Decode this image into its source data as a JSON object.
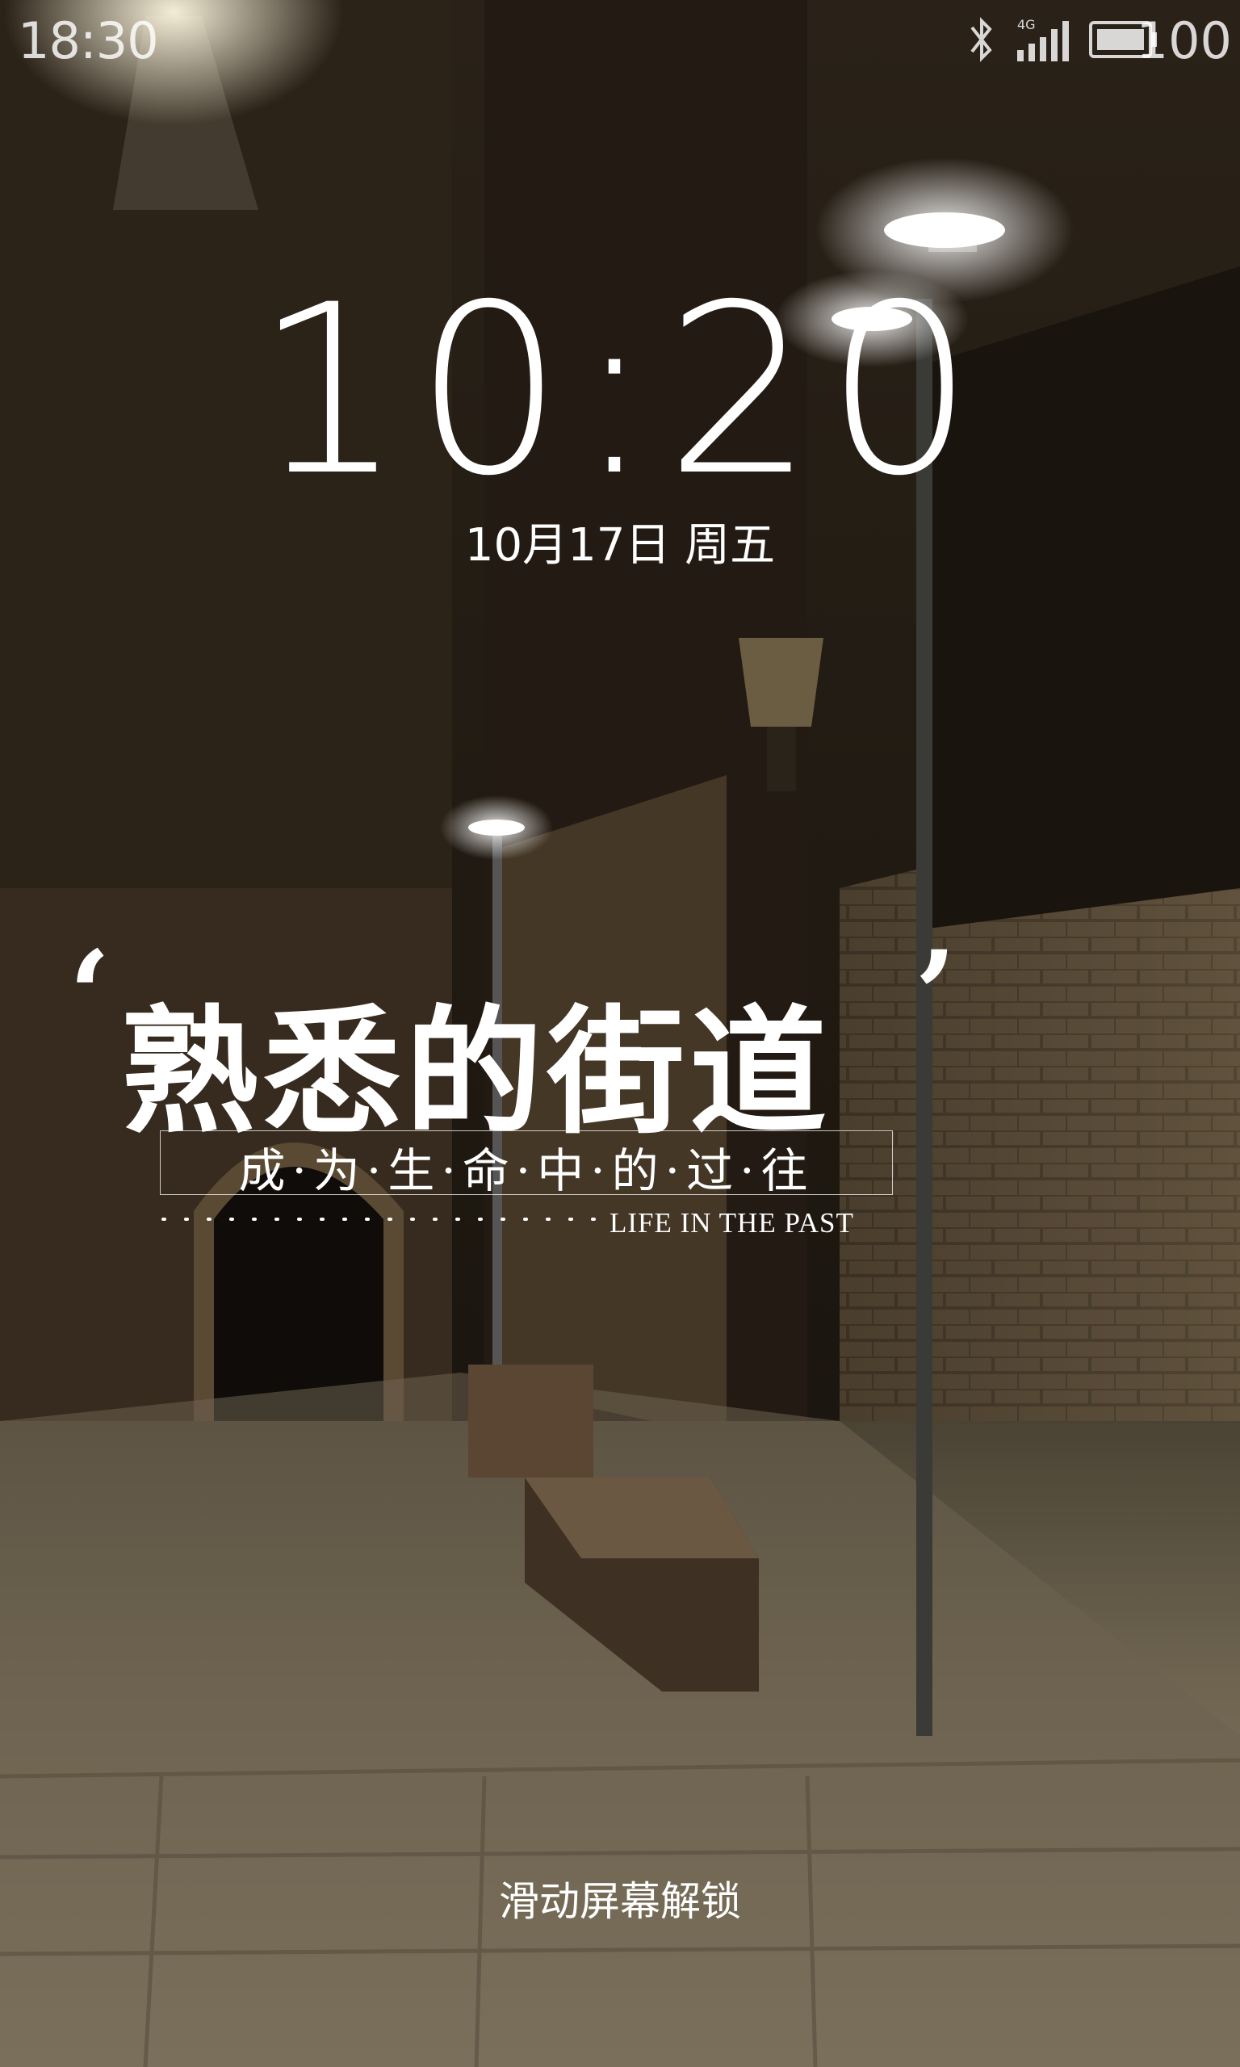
{
  "status_bar": {
    "time": "18:30",
    "battery_level": "100",
    "icons": [
      "bluetooth-icon",
      "signal-4g-icon",
      "battery-icon"
    ]
  },
  "lock_screen": {
    "clock": "10:20",
    "date": "10月17日 周五",
    "unlock_hint": "滑动屏幕解锁"
  },
  "wallpaper": {
    "title_open_quote": "‘",
    "title": "熟悉的街道",
    "title_close_quote": "’",
    "subtitle": "成·为·生·命·中·的·过·往",
    "english_tag": "LIFE IN THE PAST"
  },
  "colors": {
    "text": "#ffffff",
    "night_sky": "#1b1510",
    "wall": "#3b2f22",
    "pavement": "#7a6d58"
  }
}
